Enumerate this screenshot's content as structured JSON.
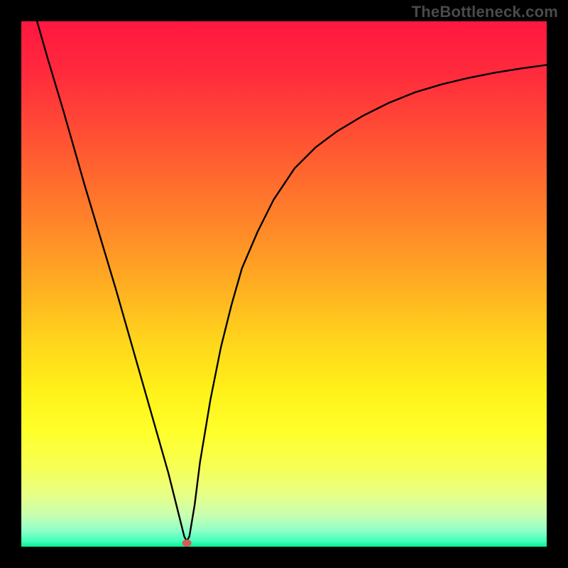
{
  "watermark": "TheBottleneck.com",
  "chart_data": {
    "type": "line",
    "title": "",
    "xlabel": "",
    "ylabel": "",
    "xlim": [
      0,
      100
    ],
    "ylim": [
      0,
      100
    ],
    "series": [
      {
        "name": "curve",
        "x": [
          3,
          5,
          8,
          10,
          12,
          15,
          18,
          20,
          22,
          24,
          26,
          28,
          30,
          31,
          31.5,
          32,
          33,
          34,
          36,
          38,
          40,
          42,
          45,
          48,
          52,
          56,
          60,
          65,
          70,
          75,
          80,
          85,
          90,
          95,
          100
        ],
        "y": [
          100,
          93,
          83,
          76,
          69,
          59,
          49,
          42,
          35,
          28,
          21,
          14,
          6,
          2,
          1,
          2,
          8,
          16,
          28,
          38,
          46,
          53,
          60,
          66,
          72,
          76,
          79,
          82,
          84.5,
          86.5,
          88,
          89.2,
          90.2,
          91,
          91.7
        ]
      }
    ],
    "marker": {
      "x": 31.5,
      "y": 0.7,
      "color": "#d55a52"
    },
    "gradient_stops": [
      {
        "offset": 0,
        "color": "#ff1740"
      },
      {
        "offset": 10,
        "color": "#ff2b3c"
      },
      {
        "offset": 20,
        "color": "#ff4a35"
      },
      {
        "offset": 30,
        "color": "#ff6a2e"
      },
      {
        "offset": 40,
        "color": "#ff8a28"
      },
      {
        "offset": 50,
        "color": "#ffad22"
      },
      {
        "offset": 60,
        "color": "#ffd21c"
      },
      {
        "offset": 70,
        "color": "#fff019"
      },
      {
        "offset": 78,
        "color": "#ffff2a"
      },
      {
        "offset": 85,
        "color": "#f6ff55"
      },
      {
        "offset": 90,
        "color": "#e8ff85"
      },
      {
        "offset": 94,
        "color": "#c8ffb0"
      },
      {
        "offset": 97,
        "color": "#8dffc8"
      },
      {
        "offset": 99,
        "color": "#40ffba"
      },
      {
        "offset": 100,
        "color": "#00f090"
      }
    ]
  }
}
